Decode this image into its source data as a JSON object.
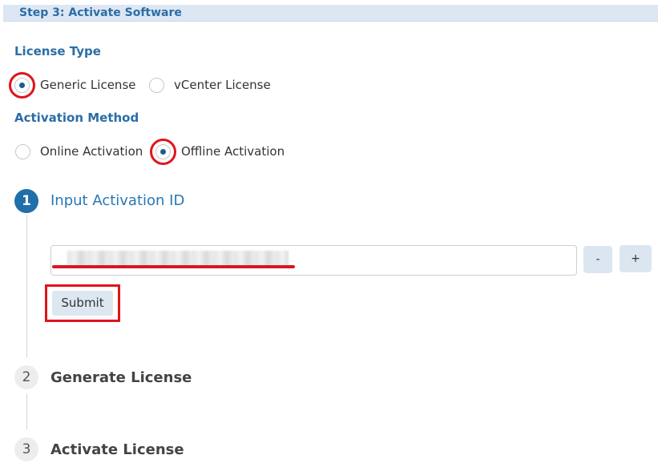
{
  "header": {
    "title": "Step 3: Activate Software"
  },
  "license_type": {
    "label": "License Type",
    "options": [
      {
        "label": "Generic License",
        "selected": true
      },
      {
        "label": "vCenter License",
        "selected": false
      }
    ]
  },
  "activation_method": {
    "label": "Activation Method",
    "options": [
      {
        "label": "Online Activation",
        "selected": false
      },
      {
        "label": "Offline Activation",
        "selected": true
      }
    ]
  },
  "steps": [
    {
      "number": "1",
      "title": "Input Activation ID",
      "active": true
    },
    {
      "number": "2",
      "title": "Generate License",
      "active": false
    },
    {
      "number": "3",
      "title": "Activate License",
      "active": false
    }
  ],
  "activation_input": {
    "value": "",
    "minus_label": "-",
    "plus_label": "+",
    "submit_label": "Submit"
  },
  "colors": {
    "accent": "#2b6da6",
    "step_active": "#1f6faa",
    "highlight": "#e0141c"
  }
}
